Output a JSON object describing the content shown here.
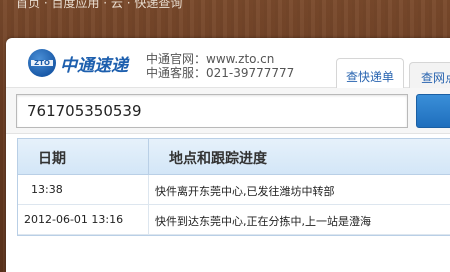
{
  "topbar": {
    "text": "首页 · 百度应用 · 云 · 快递查询"
  },
  "brand": {
    "logo_text": "中通速递",
    "logo_icon": "zto-logo"
  },
  "site_info": {
    "website": "中通官网：www.zto.cn",
    "hotline": "中通客服：021-39777777"
  },
  "tabs": [
    {
      "label": "查快递单",
      "active": true
    },
    {
      "label": "查网点",
      "active": false
    }
  ],
  "search": {
    "value": "761705350539",
    "button_icon": "search-button"
  },
  "results": {
    "headers": [
      "日期",
      "地点和跟踪进度"
    ],
    "rows": [
      {
        "date": "13:38",
        "progress": "快件离开东莞中心,已发往潍坊中转部"
      },
      {
        "date": "2012-06-01 13:16",
        "progress": "快件到达东莞中心,正在分拣中,上一站是澄海"
      }
    ]
  },
  "colors": {
    "brand_blue": "#1d5fae",
    "table_header": "#d3e6f7",
    "button": "#1f6fbd"
  }
}
